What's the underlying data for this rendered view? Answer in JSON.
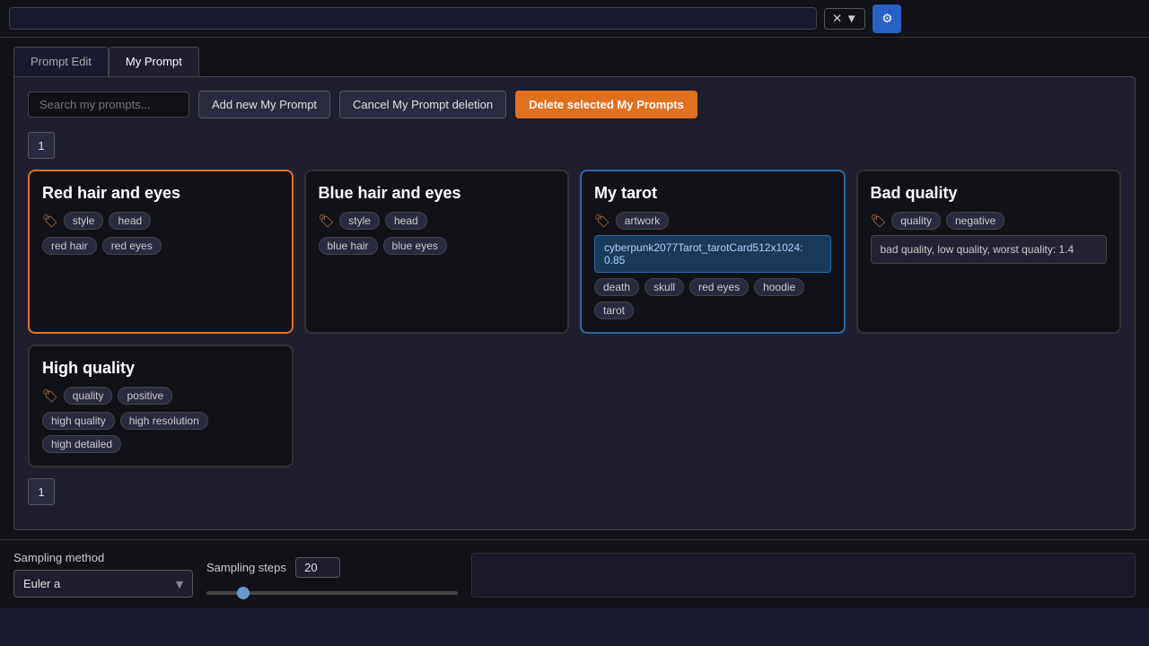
{
  "topbar": {
    "input_placeholder": "",
    "clear_label": "✕",
    "dropdown_label": "▼",
    "icon_label": "⚙"
  },
  "tabs": {
    "tab1": "Prompt Edit",
    "tab2": "My Prompt"
  },
  "toolbar": {
    "search_placeholder": "Search my prompts...",
    "add_btn": "Add new My Prompt",
    "cancel_btn": "Cancel My Prompt deletion",
    "delete_btn": "Delete selected My Prompts"
  },
  "pagination": {
    "current": "1"
  },
  "cards": [
    {
      "id": "card1",
      "title": "Red hair and eyes",
      "selected": true,
      "tags_icon": "🏷",
      "tags": [
        "style",
        "head"
      ],
      "extra_tags": [
        "red hair",
        "red eyes"
      ],
      "lora": null,
      "bad_quality": null
    },
    {
      "id": "card2",
      "title": "Blue hair and eyes",
      "selected": false,
      "tags_icon": "🏷",
      "tags": [
        "style",
        "head"
      ],
      "extra_tags": [
        "blue hair",
        "blue eyes"
      ],
      "lora": null,
      "bad_quality": null
    },
    {
      "id": "card3",
      "title": "My tarot",
      "selected": false,
      "tags_icon": "🏷",
      "tags": [
        "artwork"
      ],
      "extra_tags": [
        "death",
        "skull",
        "red eyes",
        "hoodie",
        "tarot"
      ],
      "lora": "cyberpunk2077Tarot_tarotCard512x1024: 0.85",
      "bad_quality": null
    },
    {
      "id": "card4",
      "title": "Bad quality",
      "selected": false,
      "tags_icon": "🏷",
      "tags": [
        "quality",
        "negative"
      ],
      "extra_tags": [],
      "lora": null,
      "bad_quality": "bad quality, low quality, worst quality: 1.4"
    },
    {
      "id": "card5",
      "title": "High quality",
      "selected": false,
      "tags_icon": "🏷",
      "tags": [
        "quality",
        "positive"
      ],
      "extra_tags": [
        "high quality",
        "high resolution",
        "high detailed"
      ],
      "lora": null,
      "bad_quality": null
    }
  ],
  "sampling": {
    "method_label": "Sampling method",
    "method_value": "Euler a",
    "steps_label": "Sampling steps",
    "steps_value": "20"
  }
}
